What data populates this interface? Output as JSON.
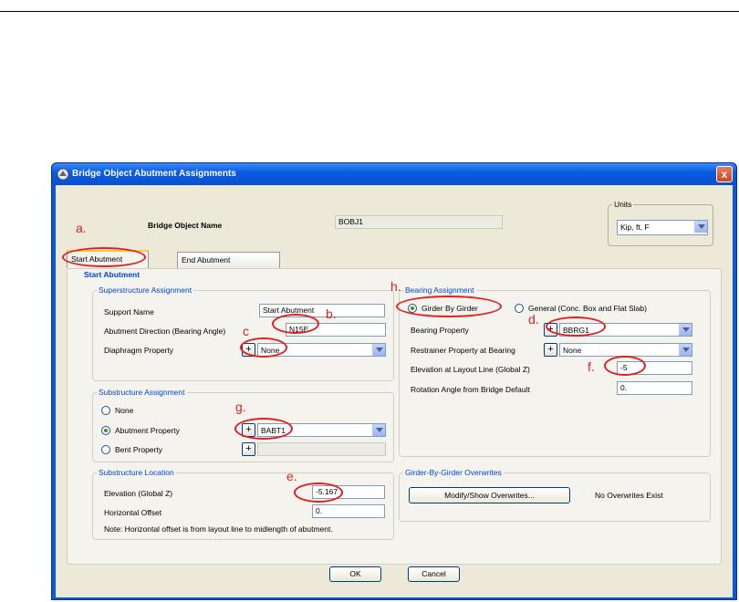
{
  "window": {
    "title": "Bridge Object Abutment Assignments",
    "close_glyph": "x"
  },
  "header": {
    "object_name_label": "Bridge Object Name",
    "object_name_value": "BOBJ1"
  },
  "units": {
    "label": "Units",
    "value": "Kip, ft, F"
  },
  "tabs": [
    {
      "label": "Start Abutment"
    },
    {
      "label": "End Abutment"
    }
  ],
  "panel_title": "Start Abutment",
  "superstructure": {
    "title": "Superstructure Assignment",
    "support_name_label": "Support Name",
    "support_name_value": "Start Abutment",
    "direction_label": "Abutment Direction (Bearing Angle)",
    "direction_value": "N15E",
    "diaphragm_label": "Diaphragm Property",
    "diaphragm_value": "None"
  },
  "substructure": {
    "title": "Substructure Assignment",
    "options": [
      {
        "label": "None"
      },
      {
        "label": "Abutment Property"
      },
      {
        "label": "Bent Property"
      }
    ],
    "abutment_property_value": "BABT1"
  },
  "location": {
    "title": "Substructure Location",
    "elevation_label": "Elevation (Global Z)",
    "elevation_value": "-5.167",
    "offset_label": "Horizontal Offset",
    "offset_value": "0.",
    "note": "Note:  Horizontal offset is from layout line to midlength of abutment."
  },
  "bearing": {
    "title": "Bearing Assignment",
    "girder_by_girder_label": "Girder By Girder",
    "general_label": "General (Conc. Box and Flat Slab)",
    "property_label": "Bearing Property",
    "property_value": "BBRG1",
    "restrainer_label": "Restrainer Property at Bearing",
    "restrainer_value": "None",
    "elevation_label": "Elevation at Layout Line (Global  Z)",
    "elevation_value": "-5",
    "rotation_label": "Rotation Angle from Bridge Default",
    "rotation_value": "0."
  },
  "overwrites": {
    "title": "Girder-By-Girder Overwrites",
    "button_label": "Modify/Show Overwrites...",
    "status": "No Overwrites Exist"
  },
  "footer": {
    "ok_label": "OK",
    "cancel_label": "Cancel"
  },
  "plus_glyph": "+",
  "annotations": [
    "a.",
    "b.",
    "c",
    "d.",
    "e.",
    "f.",
    "g.",
    "h."
  ],
  "colors": {
    "title_bar": "#0b5ce0",
    "annotation": "#e02020",
    "group_title": "#0046d5"
  }
}
